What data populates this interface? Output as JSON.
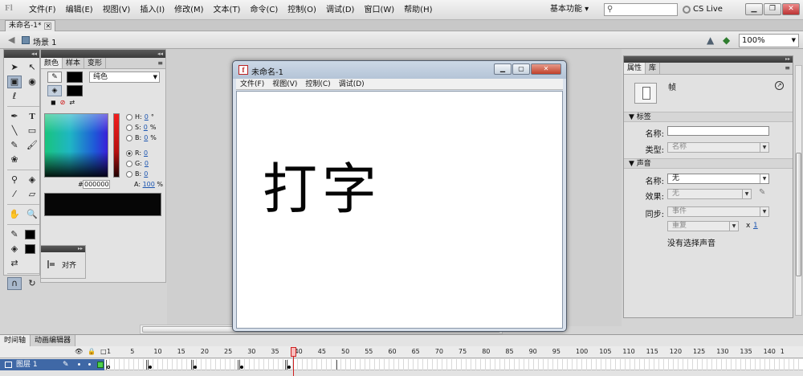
{
  "menubar": {
    "logo": "Fl",
    "items": [
      "文件(F)",
      "编辑(E)",
      "视图(V)",
      "插入(I)",
      "修改(M)",
      "文本(T)",
      "命令(C)",
      "控制(O)",
      "调试(D)",
      "窗口(W)",
      "帮助(H)"
    ],
    "workspace": "基本功能 ▾",
    "search_placeholder": "",
    "cslive": "CS Live"
  },
  "document": {
    "tab": "未命名-1*",
    "scene": "场景 1",
    "zoom": "100%"
  },
  "color_panel": {
    "tabs": [
      "颜色",
      "样本",
      "变形"
    ],
    "fill_type": "纯色",
    "hsb": [
      {
        "label": "H:",
        "value": "0",
        "unit": "°"
      },
      {
        "label": "S:",
        "value": "0",
        "unit": "%"
      },
      {
        "label": "B:",
        "value": "0",
        "unit": "%"
      },
      {
        "label": "R:",
        "value": "0",
        "unit": ""
      },
      {
        "label": "G:",
        "value": "0",
        "unit": ""
      },
      {
        "label": "B:",
        "value": "0",
        "unit": ""
      }
    ],
    "hex_label": "#",
    "hex": "000000",
    "alpha_label": "A:",
    "alpha": "100",
    "alpha_unit": "%",
    "stroke_color": "#000000",
    "fill_color": "#000000"
  },
  "align_panel": {
    "label": "对齐"
  },
  "movie_window": {
    "title": "未命名-1",
    "menu": [
      "文件(F)",
      "视图(V)",
      "控制(C)",
      "调试(D)"
    ],
    "content_text": "打字"
  },
  "properties": {
    "tabs": [
      "属性",
      "库"
    ],
    "frame_label": "帧",
    "section_label": "标签",
    "name_label": "名称:",
    "type_label": "类型:",
    "type_value": "名称",
    "section_sound": "声音",
    "sound_name_label": "名称:",
    "sound_name_value": "无",
    "effect_label": "效果:",
    "effect_value": "无",
    "sync_label": "同步:",
    "sync_value": "事件",
    "repeat_value": "重复",
    "repeat_x": "x",
    "repeat_count": "1",
    "no_sound": "没有选择声音"
  },
  "timeline": {
    "tabs": [
      "时间轴",
      "动画编辑器"
    ],
    "layer_name": "图层 1",
    "ruler": [
      "1",
      "5",
      "10",
      "15",
      "20",
      "25",
      "30",
      "35",
      "40",
      "45",
      "50",
      "55",
      "60",
      "65",
      "70",
      "75",
      "80",
      "85",
      "90",
      "95",
      "100",
      "105",
      "110",
      "115",
      "120",
      "125",
      "130",
      "135",
      "140",
      "1"
    ],
    "current_frame": "40"
  }
}
